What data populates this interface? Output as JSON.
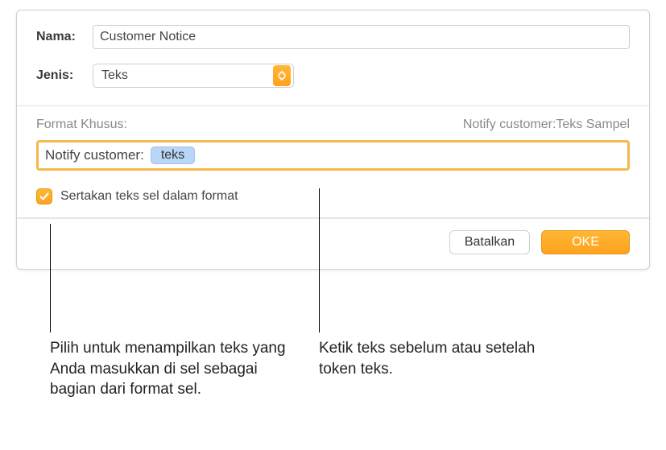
{
  "form": {
    "name_label": "Nama:",
    "name_value": "Customer Notice",
    "type_label": "Jenis:",
    "type_value": "Teks"
  },
  "format": {
    "header_left": "Format Khusus:",
    "header_right": "Notify customer:Teks Sampel",
    "prefix_text": "Notify customer:",
    "token_text": "teks"
  },
  "checkbox": {
    "label": "Sertakan teks sel dalam format",
    "checked": true
  },
  "buttons": {
    "cancel": "Batalkan",
    "ok": "OKE"
  },
  "callouts": {
    "left": "Pilih untuk menampilkan teks yang Anda masukkan di sel sebagai bagian dari format sel.",
    "right": "Ketik teks sebelum atau setelah token teks."
  }
}
